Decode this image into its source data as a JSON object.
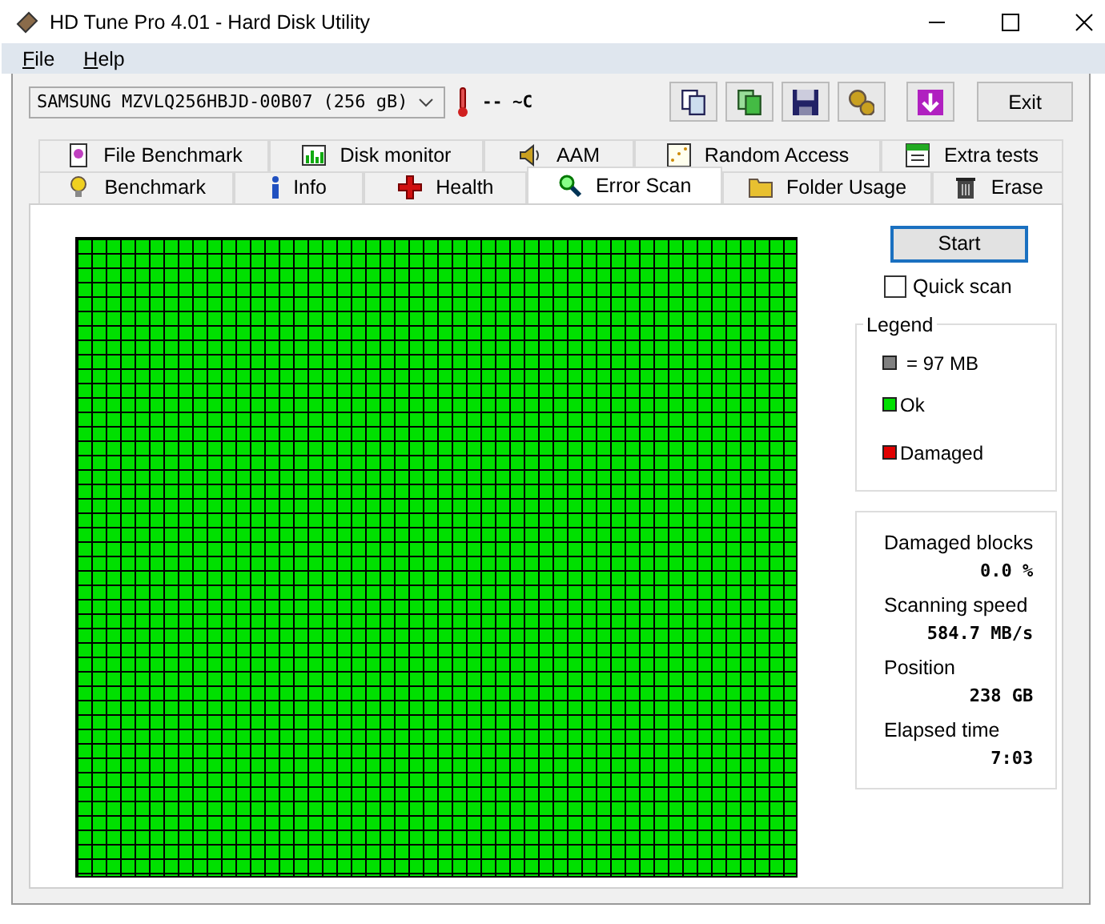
{
  "window": {
    "title": "HD Tune Pro 4.01 - Hard Disk Utility"
  },
  "menu": [
    {
      "label": "File"
    },
    {
      "label": "Help"
    }
  ],
  "toolbar": {
    "drive": "SAMSUNG MZVLQ256HBJD-00B07 (256 gB)",
    "temperature": "-- ~C",
    "exit": "Exit"
  },
  "tabs_back": [
    {
      "label": "File Benchmark",
      "selected": false
    },
    {
      "label": "Disk monitor",
      "selected": false
    },
    {
      "label": "AAM",
      "selected": false
    },
    {
      "label": "Random Access",
      "selected": false
    },
    {
      "label": "Extra tests",
      "selected": false
    }
  ],
  "tabs_front": [
    {
      "label": "Benchmark",
      "selected": false
    },
    {
      "label": "Info",
      "selected": false
    },
    {
      "label": "Health",
      "selected": false
    },
    {
      "label": "Error Scan",
      "selected": true
    },
    {
      "label": "Folder Usage",
      "selected": false
    },
    {
      "label": "Erase",
      "selected": false
    }
  ],
  "start_button": "Start",
  "quick_scan": {
    "label": "Quick scan",
    "checked": false
  },
  "legend": {
    "title": "Legend",
    "items": [
      {
        "label": "= 97 MB",
        "color": "#808080"
      },
      {
        "label": "Ok",
        "color": "#00e000"
      },
      {
        "label": "Damaged",
        "color": "#e00000"
      }
    ]
  },
  "stats": [
    {
      "label": "Damaged blocks",
      "value": "0.0 %"
    },
    {
      "label": "Scanning speed",
      "value": "584.7 MB/s"
    },
    {
      "label": "Position",
      "value": "238 GB"
    },
    {
      "label": "Elapsed time",
      "value": "7:03"
    }
  ]
}
